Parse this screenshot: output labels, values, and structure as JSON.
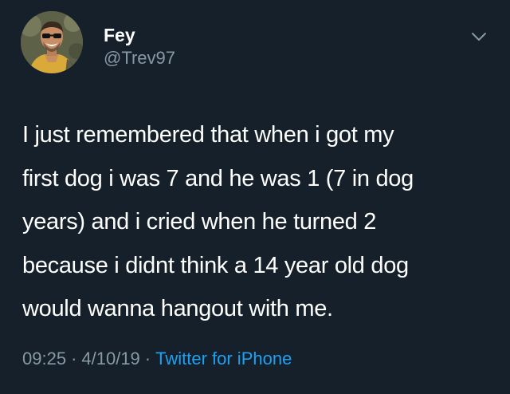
{
  "author": {
    "display_name": "Fey",
    "handle": "@Trev97"
  },
  "tweet": {
    "lines": [
      "I just remembered that when i got my",
      "first dog i was 7 and he was 1 (7 in dog",
      "years) and i cried when he turned 2",
      "because i didnt think a 14 year old dog",
      "would wanna hangout with me."
    ],
    "time": "09:25",
    "date": "4/10/19",
    "separator": "·",
    "source": "Twitter for iPhone"
  },
  "icons": {
    "menu": "chevron-down-icon"
  },
  "colors": {
    "background": "#15202b",
    "text": "#ffffff",
    "secondary_text": "#8899a6",
    "link": "#1da1f2"
  }
}
